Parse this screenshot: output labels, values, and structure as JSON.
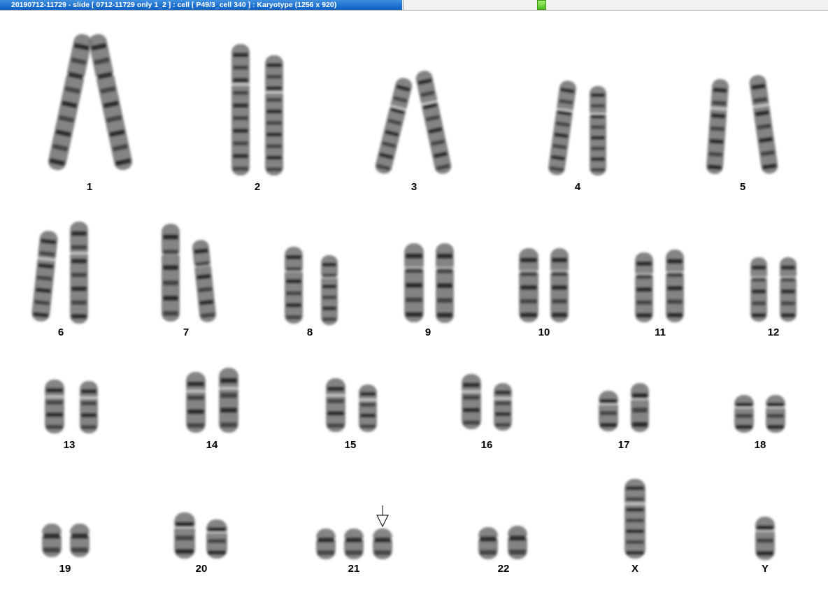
{
  "window": {
    "title": "20190712-11729 - slide [ 0712-11729 only 1_2 ] : cell [ P49/3_cell 340 ] : Karyotype  (1256 x 920)"
  },
  "karyotype": {
    "chromosomes": [
      {
        "label": "1"
      },
      {
        "label": "2"
      },
      {
        "label": "3"
      },
      {
        "label": "4"
      },
      {
        "label": "5"
      },
      {
        "label": "6"
      },
      {
        "label": "7"
      },
      {
        "label": "8"
      },
      {
        "label": "9"
      },
      {
        "label": "10"
      },
      {
        "label": "11"
      },
      {
        "label": "12"
      },
      {
        "label": "13"
      },
      {
        "label": "14"
      },
      {
        "label": "15"
      },
      {
        "label": "16"
      },
      {
        "label": "17"
      },
      {
        "label": "18"
      },
      {
        "label": "19"
      },
      {
        "label": "20"
      },
      {
        "label": "21"
      },
      {
        "label": "22"
      },
      {
        "label": "X"
      },
      {
        "label": "Y"
      }
    ],
    "copies": {
      "21": 3,
      "X": 1,
      "Y": 1
    },
    "marked": "21"
  },
  "colors": {
    "title_bar": "#0a5fc2",
    "marker": "#4fbf1c",
    "chromatin": "#6e6e6e",
    "band": "#1c1c1c"
  }
}
